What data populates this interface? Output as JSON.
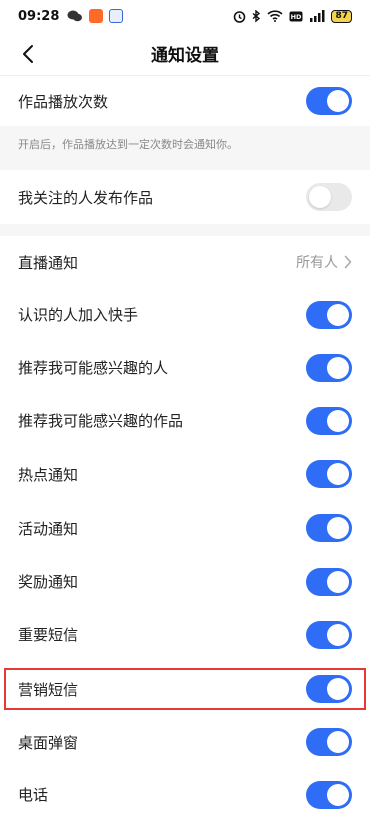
{
  "status": {
    "time": "09:28",
    "battery": "87"
  },
  "header": {
    "title": "通知设置"
  },
  "play_count": {
    "label": "作品播放次数",
    "on": true,
    "hint": "开启后，作品播放达到一定次数时会通知你。"
  },
  "follow_post": {
    "label": "我关注的人发布作品",
    "on": false
  },
  "live": {
    "label": "直播通知",
    "value": "所有人"
  },
  "settings": [
    {
      "label": "认识的人加入快手",
      "on": true
    },
    {
      "label": "推荐我可能感兴趣的人",
      "on": true
    },
    {
      "label": "推荐我可能感兴趣的作品",
      "on": true
    },
    {
      "label": "热点通知",
      "on": true
    },
    {
      "label": "活动通知",
      "on": true
    },
    {
      "label": "奖励通知",
      "on": true
    },
    {
      "label": "重要短信",
      "on": true
    },
    {
      "label": "营销短信",
      "on": true
    },
    {
      "label": "桌面弹窗",
      "on": true
    },
    {
      "label": "电话",
      "on": true
    }
  ],
  "colors": {
    "toggle_on": "#2f6df6",
    "toggle_off": "#e9e9e9",
    "highlight": "#e53935"
  }
}
